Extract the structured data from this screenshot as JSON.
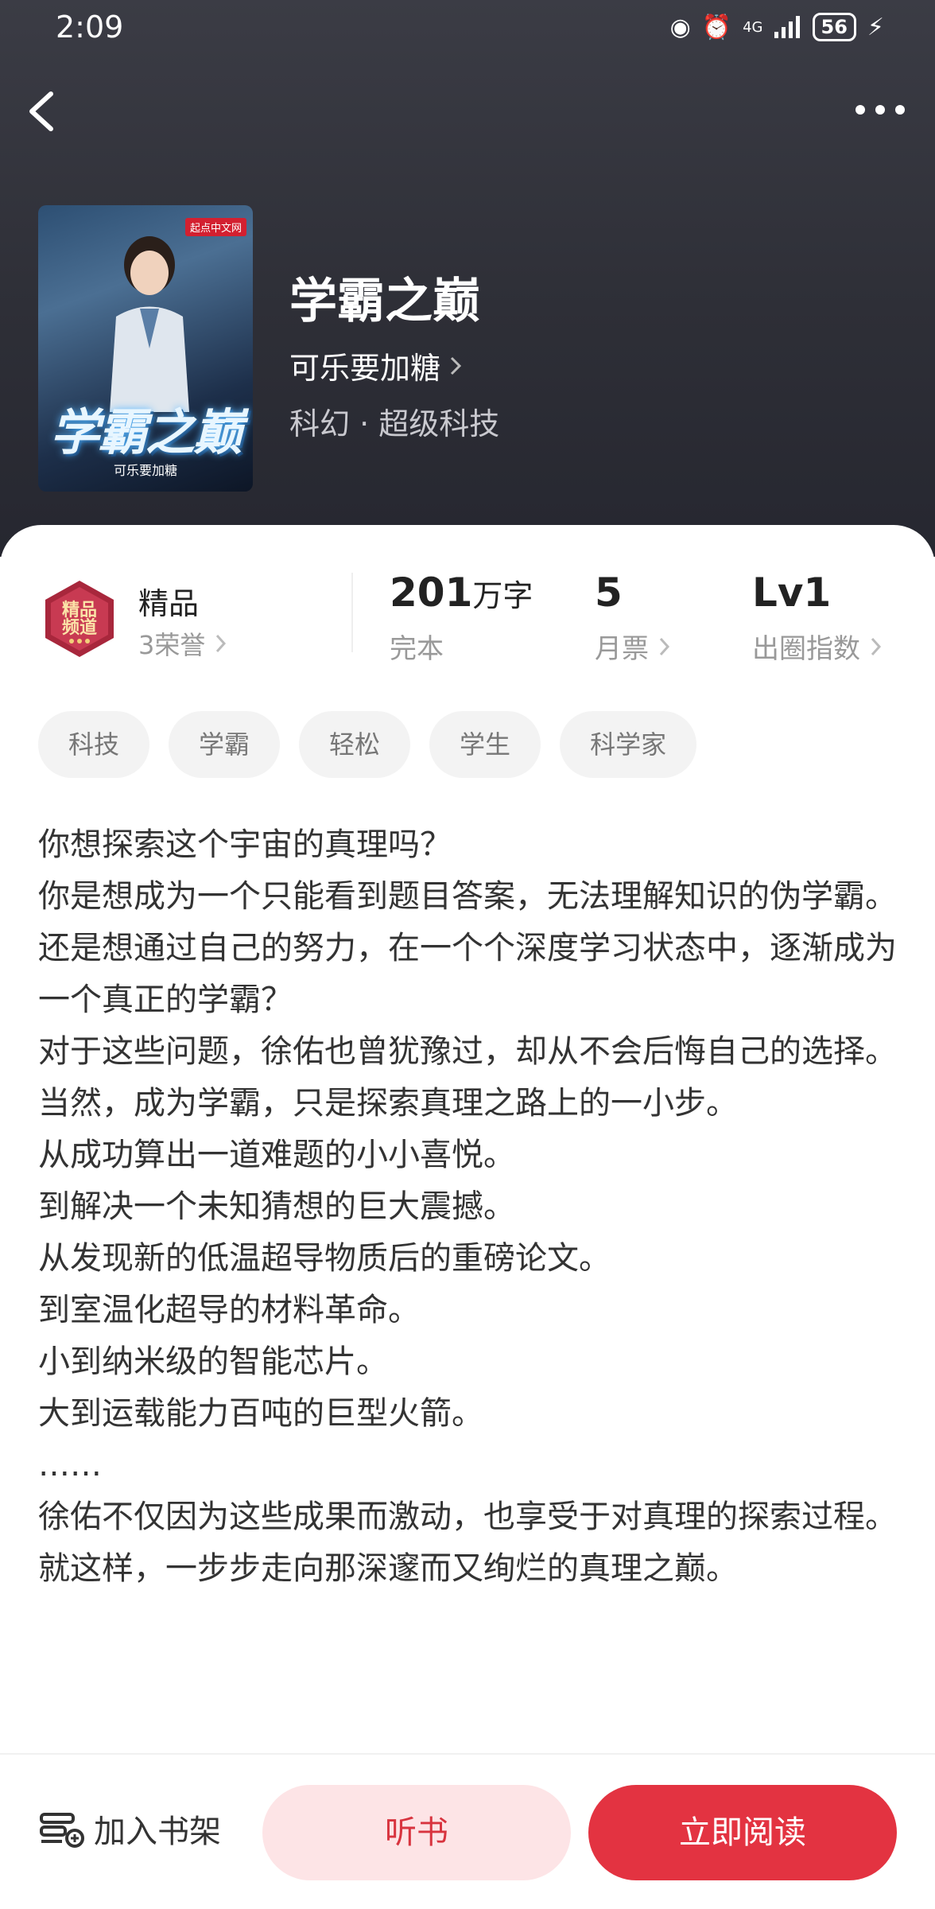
{
  "status_bar": {
    "time": "2:09",
    "battery": "56",
    "network": "4G"
  },
  "book": {
    "title": "学霸之巅",
    "author": "可乐要加糖",
    "genre": "科幻 · 超级科技",
    "cover": {
      "badge": "起点中文网",
      "title": "学霸之巅",
      "author": "可乐要加糖"
    }
  },
  "honor": {
    "emblem_text": "精品频道",
    "label": "精品",
    "honor_count": "3荣誉"
  },
  "stats": [
    {
      "value": "201",
      "unit": "万字",
      "label": "完本"
    },
    {
      "value": "5",
      "unit": "",
      "label": "月票"
    },
    {
      "value": "Lv1",
      "unit": "",
      "label": "出圈指数"
    }
  ],
  "tags": [
    "科技",
    "学霸",
    "轻松",
    "学生",
    "科学家"
  ],
  "intro": [
    "你想探索这个宇宙的真理吗？",
    "你是想成为一个只能看到题目答案，无法理解知识的伪学霸。",
    "还是想通过自己的努力，在一个个深度学习状态中，逐渐成为一个真正的学霸？",
    "对于这些问题，徐佑也曾犹豫过，却从不会后悔自己的选择。",
    "当然，成为学霸，只是探索真理之路上的一小步。",
    "从成功算出一道难题的小小喜悦。",
    "到解决一个未知猜想的巨大震撼。",
    "从发现新的低温超导物质后的重磅论文。",
    "到室温化超导的材料革命。",
    "小到纳米级的智能芯片。",
    "大到运载能力百吨的巨型火箭。",
    "……",
    "徐佑不仅因为这些成果而激动，也享受于对真理的探索过程。",
    "就这样，一步步走向那深邃而又绚烂的真理之巅。"
  ],
  "bottom_bar": {
    "add_shelf": "加入书架",
    "listen": "听书",
    "read": "立即阅读"
  },
  "colors": {
    "accent": "#e33341",
    "listen_bg": "#fde4e6",
    "header_bg": "#2e2f37"
  }
}
